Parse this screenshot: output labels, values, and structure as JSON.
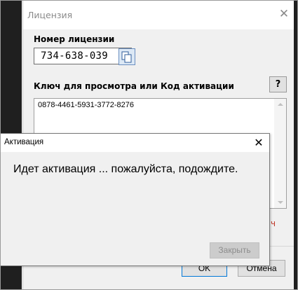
{
  "license_dialog": {
    "title": "Лицензия",
    "license_number_label": "Номер лицензии",
    "license_number_value": "734-638-039",
    "key_label": "Ключ для просмотра или Код активации",
    "help_label": "?",
    "key_value": "0878-4461-5931-3772-8276",
    "partial_text": "ч",
    "ok_label": "OK",
    "cancel_label": "Отмена"
  },
  "activation_dialog": {
    "title": "Активация",
    "message": "Идет активация ... пожалуйста, подождите.",
    "close_label": "Закрыть"
  }
}
